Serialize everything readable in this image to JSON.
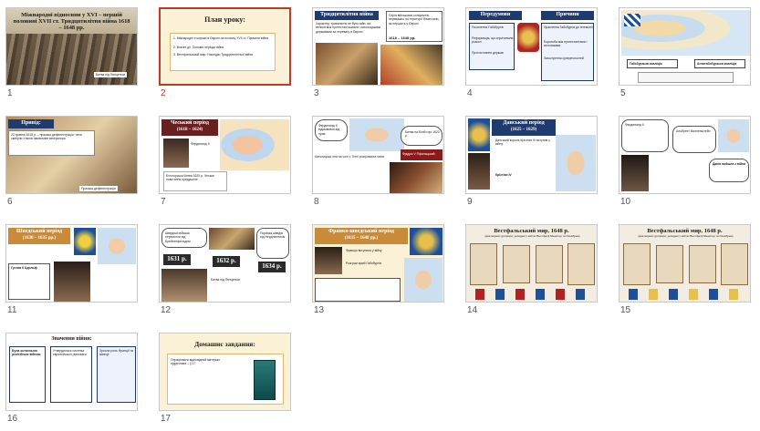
{
  "slides": [
    {
      "num": "1",
      "title": "Міжнародні відносини у XVI – першій половині XVII ст. Тридцятилітня війна 1618 – 1648 рр.",
      "caption": "Битва під Лютценом"
    },
    {
      "num": "2",
      "title": "План уроку:",
      "items": [
        "1. Міжнародні стосунки в Європі на початку XVII ст. Причини війни",
        "2. Воєнні дії. Основні періоди війни",
        "3. Вестфальський мир. Наслідки Тридцятилітньої війни"
      ]
    },
    {
      "num": "3",
      "title": "Тридцятилітня війна",
      "desc": "Характер: тривалістю не було війн, які велися між протестантськими і католицькими державами за перевагу в Європі",
      "box": "Серія військових конфліктів, переважно на території Німеччини, за першість у Європі",
      "years": "1618 – 1648 рр."
    },
    {
      "num": "4",
      "title_left": "Передумови",
      "title_right": "Причини",
      "left_items": [
        "Посилення Габсбургів",
        "Реформація, що спричинила розкол",
        "Протистояння держав"
      ],
      "right_items": [
        "Прагнення Габсбургів до гегемонії",
        "Боротьба між протестантами і католиками",
        "Загострення суперечностей"
      ]
    },
    {
      "num": "5",
      "labels": [
        "Габсбурзька коаліція",
        "Антигабсбурзька коаліція"
      ]
    },
    {
      "num": "6",
      "title": "Привід:",
      "desc": "23 травня 1618 р. – празька дефенестрація: чехи скинули з вікна намісників імператора",
      "caption": "Празька дефенестрація"
    },
    {
      "num": "7",
      "title": "Чеський період",
      "years": "(1618 – 1624)",
      "note": "Фердинанд II",
      "bottom": "Білогорська битва 1620 р. Чеське повстання придушене"
    },
    {
      "num": "8",
      "notes": [
        "Фердинанд II відмовився від прав",
        "Битва на Білій горі 1620 р.",
        "Фрідріх V Пфальцький"
      ],
      "bottom": "Католицька ліга на чолі з Тіллі розгромила чехів"
    },
    {
      "num": "9",
      "title": "Данський період",
      "years": "(1625 – 1629)",
      "note": "Крістіан IV",
      "side": "Данський король Крістіан IV вступив у війну"
    },
    {
      "num": "10",
      "notes": [
        "Фердинанд II",
        "Альбрехт Валленштейн",
        "Любекський мир 1629 р."
      ],
      "bottom": "Данія вийшла з війни"
    },
    {
      "num": "11",
      "title": "Шведський період",
      "years": "(1630 – 1635 рр.)",
      "note": "Густав II Адольф"
    },
    {
      "num": "12",
      "years": [
        "1631 р.",
        "1632 р.",
        "1634 р."
      ],
      "notes": [
        "Шведські війська перемогли під Брейтенфельдом",
        "Битва під Лютценом",
        "Поразка шведів під Нердлінгеном"
      ]
    },
    {
      "num": "13",
      "title": "Франко-шведський період",
      "years": "(1635 – 1648 рр.)",
      "notes": [
        "Франція вступила у війну",
        "Розгром армії Габсбургів"
      ]
    },
    {
      "num": "14",
      "title": "Вестфальський мир, 1648 р.",
      "subtitle": "(два мирних договори, укладені у містах Вестфалії Мюнстер та Оснабрюк)"
    },
    {
      "num": "15",
      "title": "Вестфальський мир, 1648 р.",
      "subtitle": "(два мирних договори, укладені у містах Вестфалії Мюнстер та Оснабрюк)"
    },
    {
      "num": "16",
      "title": "Значення війни:",
      "cols": [
        "Була останньою релігійною війною",
        "Утвердилася система європейської рівноваги",
        "Зросла роль Франції та Швеції"
      ]
    },
    {
      "num": "17",
      "title": "Домашнє завдання:",
      "items": [
        "Опрацювати відповідний матеріал підручника – § 17"
      ]
    }
  ]
}
